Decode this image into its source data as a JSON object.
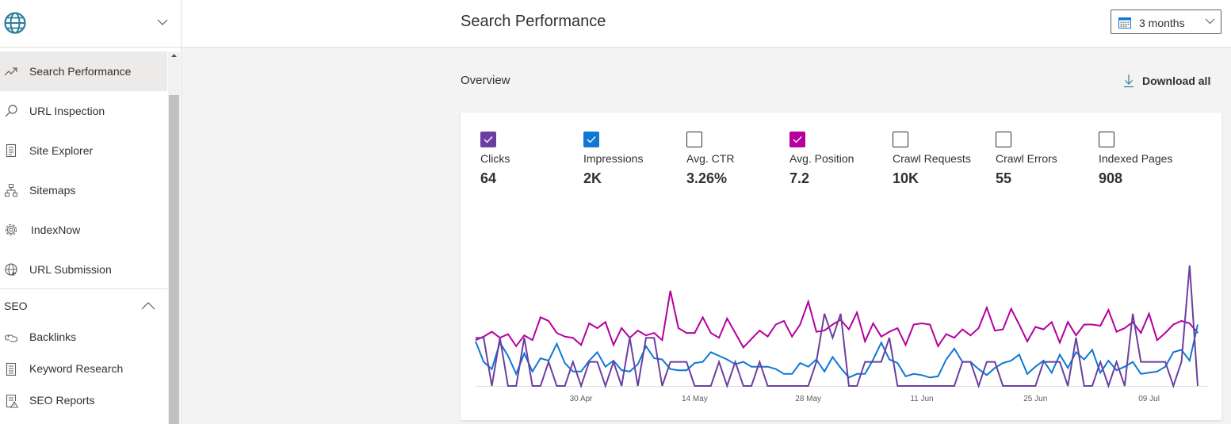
{
  "sidebar": {
    "logo_icon": "globe-icon",
    "site_selector_icon": "chevron-down-icon",
    "items": [
      {
        "label": "Search Performance",
        "icon": "trending-up-icon",
        "active": true
      },
      {
        "label": "URL Inspection",
        "icon": "search-icon",
        "active": false
      },
      {
        "label": "Site Explorer",
        "icon": "document-list-icon",
        "active": false
      },
      {
        "label": "Sitemaps",
        "icon": "sitemap-icon",
        "active": false
      },
      {
        "label": "IndexNow",
        "icon": "gear-icon",
        "active": false
      },
      {
        "label": "URL Submission",
        "icon": "globe-add-icon",
        "active": false
      }
    ],
    "section": {
      "label": "SEO",
      "expanded": true,
      "items": [
        {
          "label": "Backlinks",
          "icon": "link-icon"
        },
        {
          "label": "Keyword Research",
          "icon": "document-lines-icon"
        },
        {
          "label": "SEO Reports",
          "icon": "report-warning-icon"
        }
      ]
    }
  },
  "header": {
    "title": "Search Performance",
    "date_range": {
      "value": "3 months",
      "icon": "calendar-icon"
    }
  },
  "main": {
    "overview_title": "Overview",
    "download_label": "Download all",
    "metrics": [
      {
        "name": "Clicks",
        "value": "64",
        "checked": true,
        "color": "#6b3fa0"
      },
      {
        "name": "Impressions",
        "value": "2K",
        "checked": true,
        "color": "#0f78d4"
      },
      {
        "name": "Avg. CTR",
        "value": "3.26%",
        "checked": false,
        "color": "#323130"
      },
      {
        "name": "Avg. Position",
        "value": "7.2",
        "checked": true,
        "color": "#b4009e"
      },
      {
        "name": "Crawl Requests",
        "value": "10K",
        "checked": false,
        "color": "#323130"
      },
      {
        "name": "Crawl Errors",
        "value": "55",
        "checked": false,
        "color": "#323130"
      },
      {
        "name": "Indexed Pages",
        "value": "908",
        "checked": false,
        "color": "#323130"
      }
    ]
  },
  "chart_data": {
    "type": "line",
    "title": "",
    "xlabel": "",
    "ylabel": "",
    "x_start": "17 Apr",
    "x_end": "15 Jul",
    "x_count": 90,
    "x_ticks": [
      {
        "label": "30 Apr",
        "index": 13
      },
      {
        "label": "14 May",
        "index": 27
      },
      {
        "label": "28 May",
        "index": 41
      },
      {
        "label": "11 Jun",
        "index": 55
      },
      {
        "label": "25 Jun",
        "index": 69
      },
      {
        "label": "09 Jul",
        "index": 83
      }
    ],
    "grid": false,
    "legend": "none",
    "series": [
      {
        "name": "Clicks",
        "color": "#6b3fa0",
        "ylim": [
          0,
          5
        ],
        "values": [
          2,
          2,
          0,
          2,
          0,
          0,
          2,
          0,
          0,
          1,
          0,
          0,
          1,
          0,
          1,
          1,
          0,
          1,
          0,
          2,
          0,
          2,
          2,
          0,
          1,
          1,
          1,
          0,
          0,
          0,
          1,
          0,
          1,
          0,
          0,
          1,
          0,
          0,
          0,
          0,
          0,
          0,
          1,
          3,
          2,
          3,
          0,
          0,
          1,
          1,
          1,
          2,
          0,
          0,
          0,
          0,
          0,
          0,
          0,
          0,
          1,
          1,
          0,
          1,
          1,
          0,
          0,
          0,
          0,
          0,
          1,
          1,
          1,
          0,
          2,
          0,
          0,
          1,
          0,
          1,
          0,
          3,
          1,
          1,
          1,
          1,
          0,
          1,
          5,
          0
        ]
      },
      {
        "name": "Impressions",
        "color": "#0f78d4",
        "ylim": [
          0,
          100
        ],
        "values": [
          37,
          20,
          14,
          36,
          25,
          10,
          27,
          12,
          23,
          21,
          35,
          19,
          12,
          12,
          21,
          28,
          16,
          21,
          13,
          12,
          18,
          33,
          23,
          22,
          14,
          13,
          13,
          19,
          20,
          28,
          25,
          22,
          18,
          20,
          16,
          16,
          16,
          14,
          10,
          10,
          19,
          16,
          22,
          12,
          24,
          15,
          7,
          10,
          10,
          22,
          36,
          22,
          19,
          8,
          10,
          9,
          7,
          8,
          22,
          31,
          20,
          20,
          14,
          9,
          15,
          19,
          21,
          26,
          10,
          16,
          21,
          11,
          26,
          15,
          28,
          22,
          30,
          11,
          21,
          13,
          16,
          20,
          10,
          11,
          12,
          16,
          28,
          30,
          21,
          51
        ]
      },
      {
        "name": "Avg. Position",
        "color": "#b4009e",
        "ylim": [
          0,
          100
        ],
        "values": [
          38,
          41,
          45,
          40,
          43,
          33,
          42,
          38,
          57,
          54,
          44,
          41,
          40,
          34,
          52,
          48,
          53,
          34,
          48,
          40,
          46,
          42,
          44,
          38,
          79,
          48,
          44,
          44,
          57,
          44,
          40,
          56,
          44,
          32,
          39,
          46,
          41,
          51,
          54,
          41,
          51,
          70,
          45,
          46,
          51,
          55,
          47,
          61,
          37,
          52,
          41,
          45,
          48,
          34,
          51,
          52,
          51,
          33,
          43,
          40,
          47,
          42,
          48,
          65,
          46,
          47,
          64,
          51,
          37,
          49,
          47,
          53,
          36,
          53,
          42,
          51,
          51,
          50,
          63,
          45,
          48,
          53,
          44,
          60,
          38,
          44,
          51,
          54,
          52,
          44
        ]
      }
    ]
  }
}
